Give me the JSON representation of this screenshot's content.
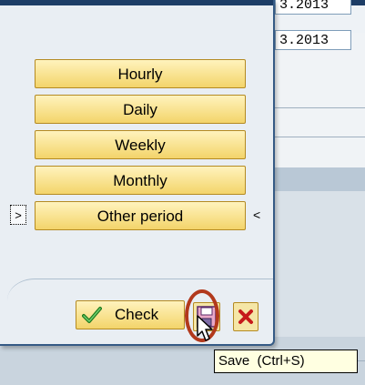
{
  "background": {
    "date_top": "3.2013",
    "date_bottom": "3.2013"
  },
  "dialog": {
    "buttons": [
      {
        "label": "Hourly"
      },
      {
        "label": "Daily"
      },
      {
        "label": "Weekly"
      },
      {
        "label": "Monthly"
      },
      {
        "label": "Other period"
      }
    ],
    "marker_left": ">",
    "marker_right": "<",
    "check_label": "Check",
    "save_icon": "save-icon",
    "cancel_icon": "cancel-icon"
  },
  "tooltip": {
    "text": "Save  (Ctrl+S)"
  },
  "colors": {
    "button_gradient_top": "#fff3bd",
    "button_gradient_bottom": "#f3d46a",
    "button_border": "#b48a22",
    "highlight_ring": "#b2391c",
    "title_bar": "#1d3d66"
  }
}
